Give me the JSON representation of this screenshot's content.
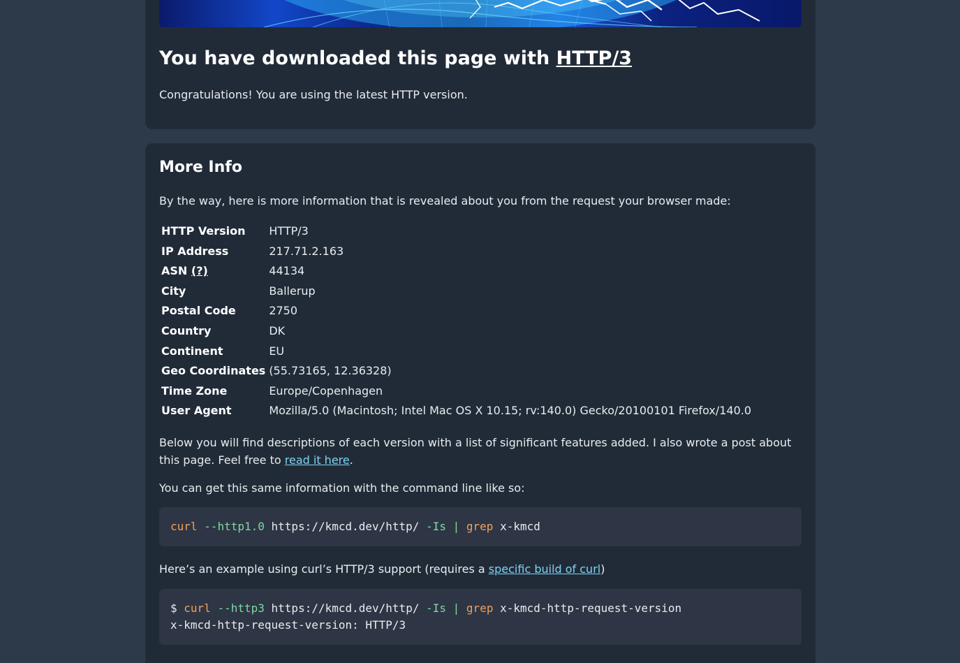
{
  "status": {
    "heading_prefix": "You have downloaded this page with",
    "heading_link": "HTTP/3",
    "congrats": "Congratulations! You are using the latest HTTP version."
  },
  "more_info": {
    "title": "More Info",
    "intro": "By the way, here is more information that is revealed about you from the request your browser made:",
    "rows": [
      {
        "label": "HTTP Version",
        "value": "HTTP/3"
      },
      {
        "label": "IP Address",
        "value": "217.71.2.163"
      },
      {
        "label": "ASN",
        "help": "(?)",
        "value": "44134"
      },
      {
        "label": "City",
        "value": "Ballerup"
      },
      {
        "label": "Postal Code",
        "value": "2750"
      },
      {
        "label": "Country",
        "value": "DK"
      },
      {
        "label": "Continent",
        "value": "EU"
      },
      {
        "label": "Geo Coordinates",
        "value": "(55.73165, 12.36328)"
      },
      {
        "label": "Time Zone",
        "value": "Europe/Copenhagen"
      },
      {
        "label": "User Agent",
        "value": "Mozilla/5.0 (Macintosh; Intel Mac OS X 10.15; rv:140.0) Gecko/20100101 Firefox/140.0"
      }
    ],
    "descriptions_text": "Below you will find descriptions of each version with a list of significant features added. I also wrote a post about this page. Feel free to",
    "descriptions_link": "read it here",
    "descriptions_end": ".",
    "cli_text": "You can get this same information with the command line like so:",
    "code1": {
      "cmd": "curl",
      "flag": "--http1.0",
      "url": "https://kmcd.dev/http/",
      "opt": "-Is",
      "pipe": "|",
      "grep": "grep",
      "arg": "x-kmcd"
    },
    "http3_text": "Here’s an example using curl’s HTTP/3 support (requires a",
    "http3_link": "specific build of curl",
    "http3_end": ")",
    "code2": {
      "prompt": "$",
      "cmd": "curl",
      "flag": "--http3",
      "url": "https://kmcd.dev/http/",
      "opt": "-Is",
      "pipe": "|",
      "grep": "grep",
      "arg": "x-kmcd-http-request-version",
      "output": "x-kmcd-http-request-version: HTTP/3"
    }
  },
  "colors": {
    "page_bg": "#2d3a4a",
    "card_bg": "#212b38",
    "code_bg": "#2e3544",
    "link": "#7fd3f2",
    "code_command": "#f0a15a",
    "code_flag": "#7cd9a4"
  }
}
